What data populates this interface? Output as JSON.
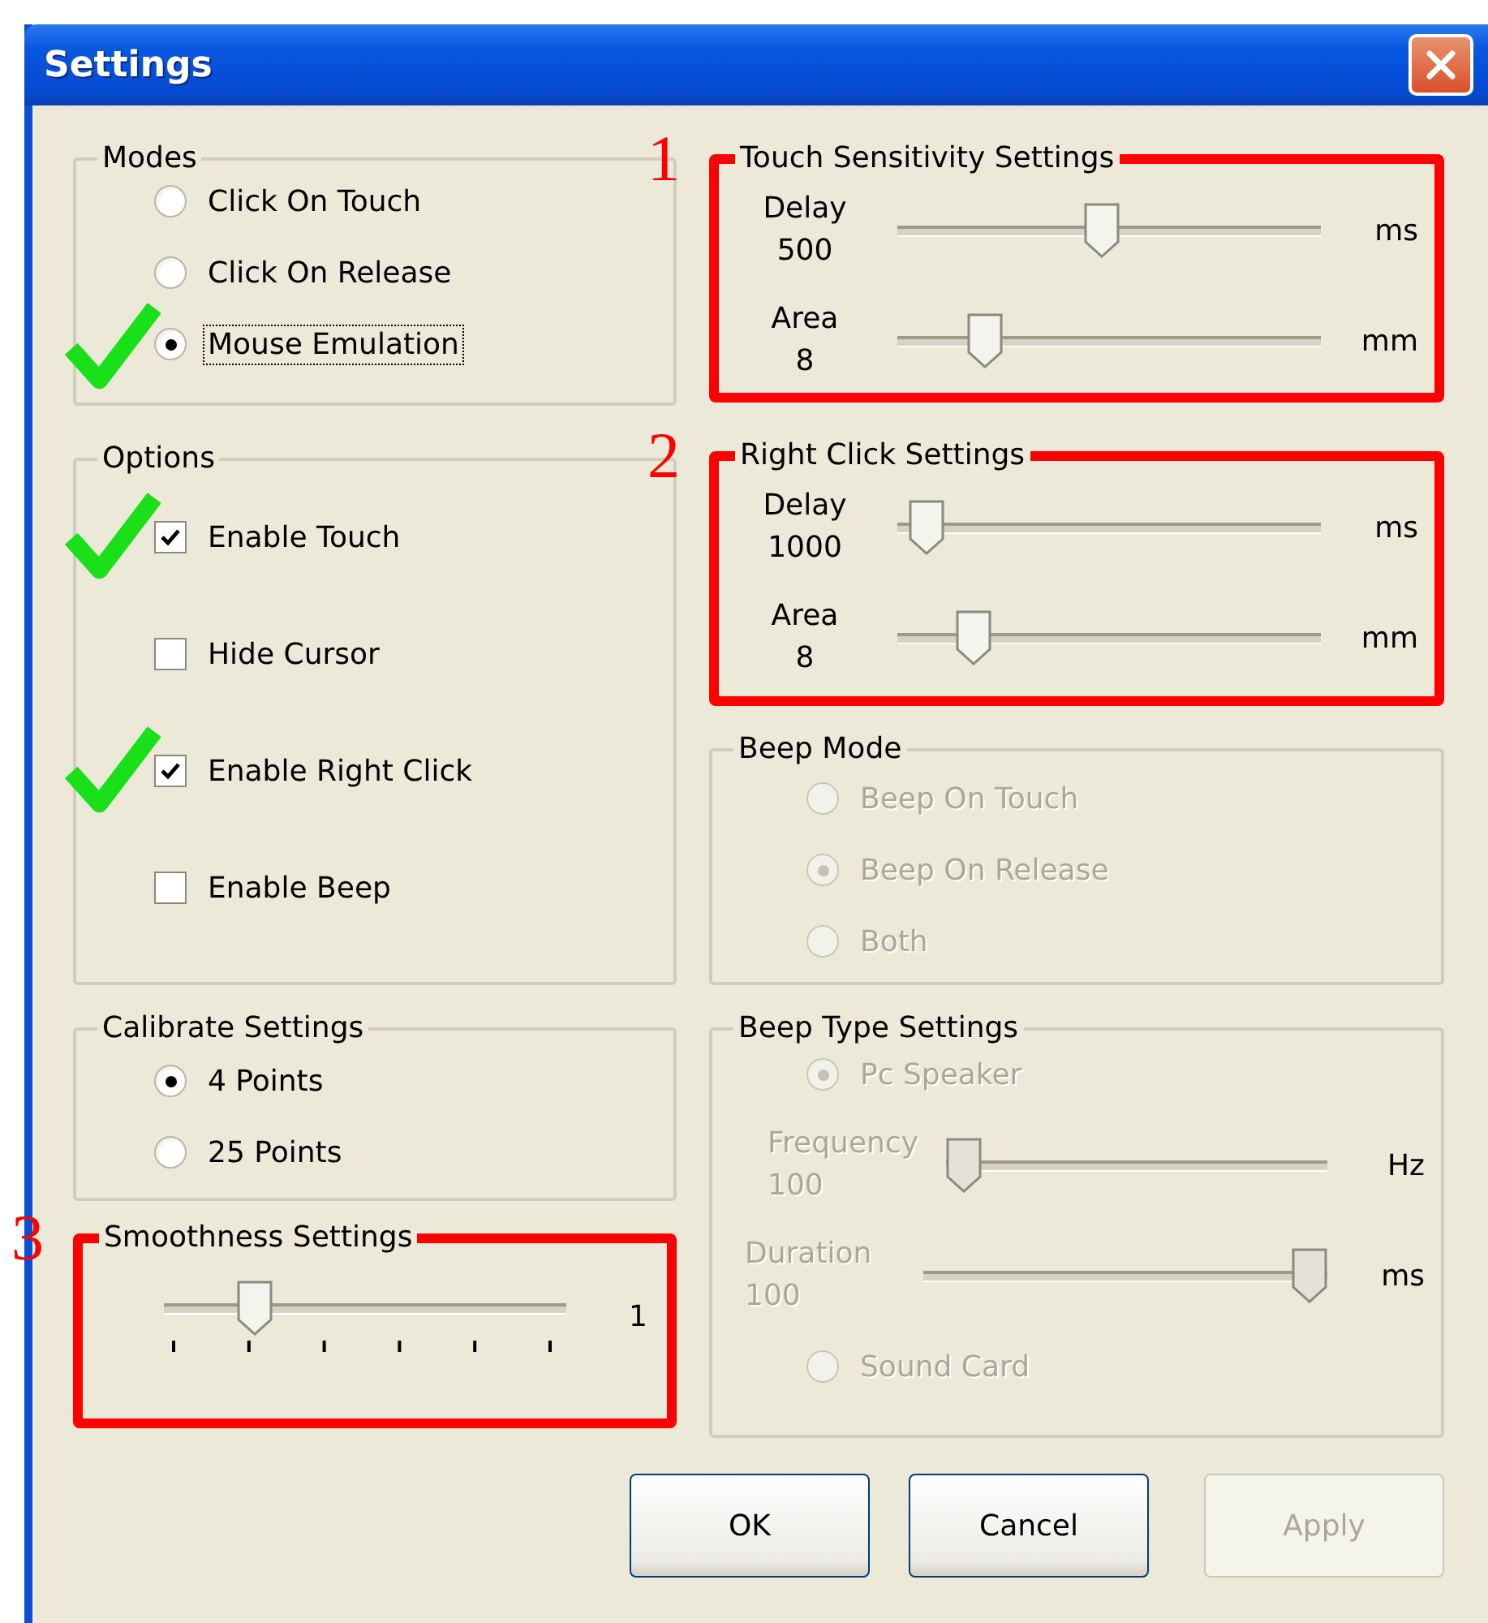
{
  "window": {
    "title": "Settings"
  },
  "left_groups": [
    {
      "title": "Modes",
      "items": [
        {
          "kind": "radio",
          "label": "Click On Touch",
          "selected": false,
          "disabled": false,
          "ticked": false,
          "focused": false
        },
        {
          "kind": "radio",
          "label": "Click On Release",
          "selected": false,
          "disabled": false,
          "ticked": false,
          "focused": false
        },
        {
          "kind": "radio",
          "label": "Mouse Emulation",
          "selected": true,
          "disabled": false,
          "ticked": true,
          "focused": true
        }
      ]
    },
    {
      "title": "Options",
      "items": [
        {
          "kind": "checkbox",
          "label": "Enable Touch",
          "checked": true,
          "ticked": true
        },
        {
          "kind": "checkbox",
          "label": "Hide Cursor",
          "checked": false,
          "ticked": false
        },
        {
          "kind": "checkbox",
          "label": "Enable Right Click",
          "checked": true,
          "ticked": true
        },
        {
          "kind": "checkbox",
          "label": "Enable Beep",
          "checked": false,
          "ticked": false
        }
      ]
    },
    {
      "title": "Calibrate Settings",
      "items": [
        {
          "kind": "radio",
          "label": "4 Points",
          "selected": true,
          "disabled": false,
          "ticked": false,
          "focused": false
        },
        {
          "kind": "radio",
          "label": "25 Points",
          "selected": false,
          "disabled": false,
          "ticked": false,
          "focused": false
        }
      ]
    },
    {
      "title": "Smoothness Settings",
      "marker": "3",
      "items": [
        {
          "kind": "tick_slider",
          "value": "1",
          "level": 0.2,
          "disabled": false
        }
      ]
    }
  ],
  "right_groups": [
    {
      "title": "Touch Sensitivity Settings",
      "marker": "1",
      "items": [
        {
          "kind": "slider",
          "label": "Delay",
          "value": "500",
          "unit": "ms",
          "level": 0.48,
          "disabled": false
        },
        {
          "kind": "slider",
          "label": "Area",
          "value": "8",
          "unit": "mm",
          "level": 0.18,
          "disabled": false
        }
      ]
    },
    {
      "title": "Right Click Settings",
      "marker": "2",
      "items": [
        {
          "kind": "slider",
          "label": "Delay",
          "value": "1000",
          "unit": "ms",
          "level": 0.03,
          "disabled": false
        },
        {
          "kind": "slider",
          "label": "Area",
          "value": "8",
          "unit": "mm",
          "level": 0.15,
          "disabled": false
        }
      ]
    },
    {
      "title": "Beep Mode",
      "items": [
        {
          "kind": "radio",
          "label": "Beep On Touch",
          "selected": false,
          "disabled": true,
          "ticked": false,
          "focused": false
        },
        {
          "kind": "radio",
          "label": "Beep On Release",
          "selected": true,
          "disabled": true,
          "ticked": false,
          "focused": false
        },
        {
          "kind": "radio",
          "label": "Both",
          "selected": false,
          "disabled": true,
          "ticked": false,
          "focused": false
        }
      ]
    },
    {
      "title": "Beep Type Settings",
      "items": [
        {
          "kind": "radio",
          "label": "Pc Speaker",
          "selected": true,
          "disabled": true,
          "ticked": false,
          "focused": false
        },
        {
          "kind": "slider",
          "label": "Frequency",
          "value": "100",
          "unit": "Hz",
          "level": 0.0,
          "disabled": true
        },
        {
          "kind": "slider",
          "label": "Duration",
          "value": "100",
          "unit": "ms",
          "level": 1.0,
          "disabled": true
        },
        {
          "kind": "radio",
          "label": "Sound Card",
          "selected": false,
          "disabled": true,
          "ticked": false,
          "focused": false
        }
      ]
    }
  ],
  "buttons": [
    {
      "label": "OK",
      "disabled": false
    },
    {
      "label": "Cancel",
      "disabled": false
    },
    {
      "label": "Apply",
      "disabled": true
    }
  ]
}
